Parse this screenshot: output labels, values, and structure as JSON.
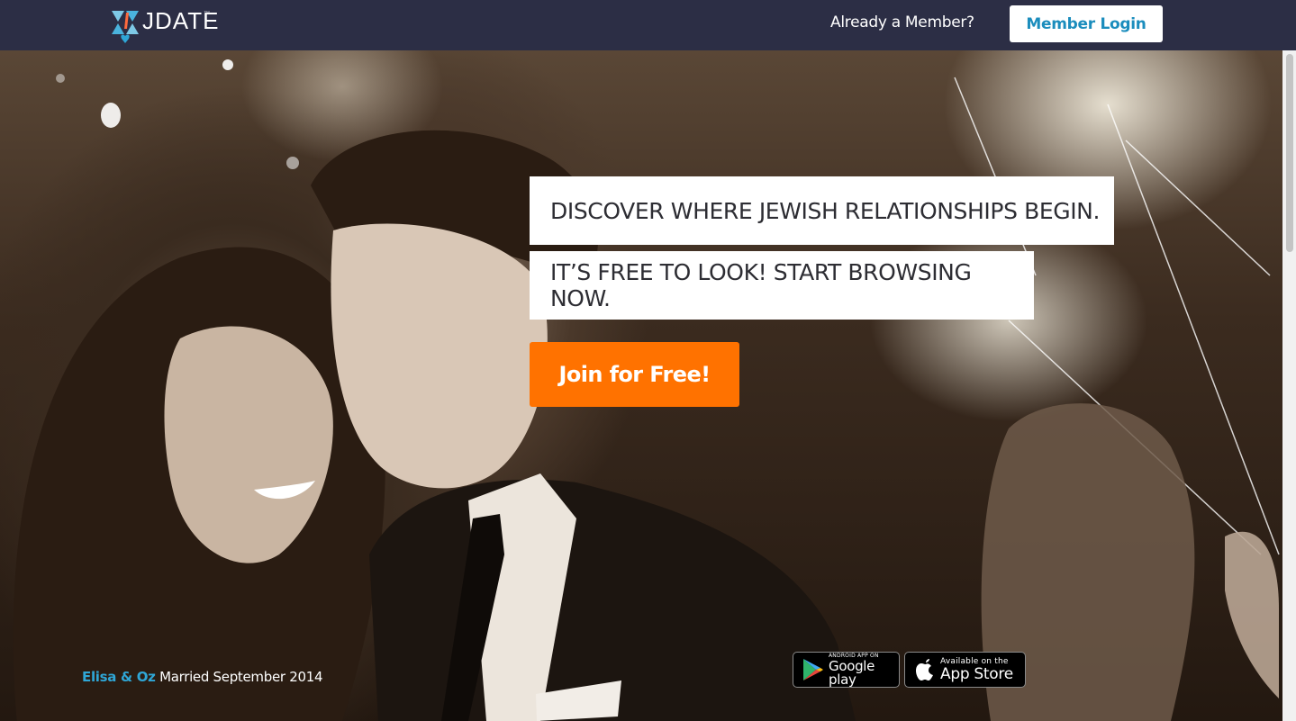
{
  "header": {
    "logo_text": "JDATE",
    "logo_tm": "™",
    "already_member": "Already a Member?",
    "login_label": "Member Login"
  },
  "hero": {
    "headline_1": "DISCOVER WHERE JEWISH RELATIONSHIPS BEGIN.",
    "headline_2": "IT’S FREE TO LOOK! START BROWSING NOW.",
    "join_label": "Join for Free!",
    "caption_names": "Elisa & Oz",
    "caption_text": "Married September 2014"
  },
  "badges": {
    "google_small": "ANDROID APP ON",
    "google_big": "Google play",
    "apple_small": "Available on the",
    "apple_big": "App Store"
  },
  "colors": {
    "topbar": "#2c2e45",
    "login_text": "#1b8dbd",
    "join_button": "#ff7200",
    "caption_names": "#2fa6d6"
  },
  "icons": [
    "jdate-star-logo-icon",
    "google-play-icon",
    "apple-icon"
  ]
}
